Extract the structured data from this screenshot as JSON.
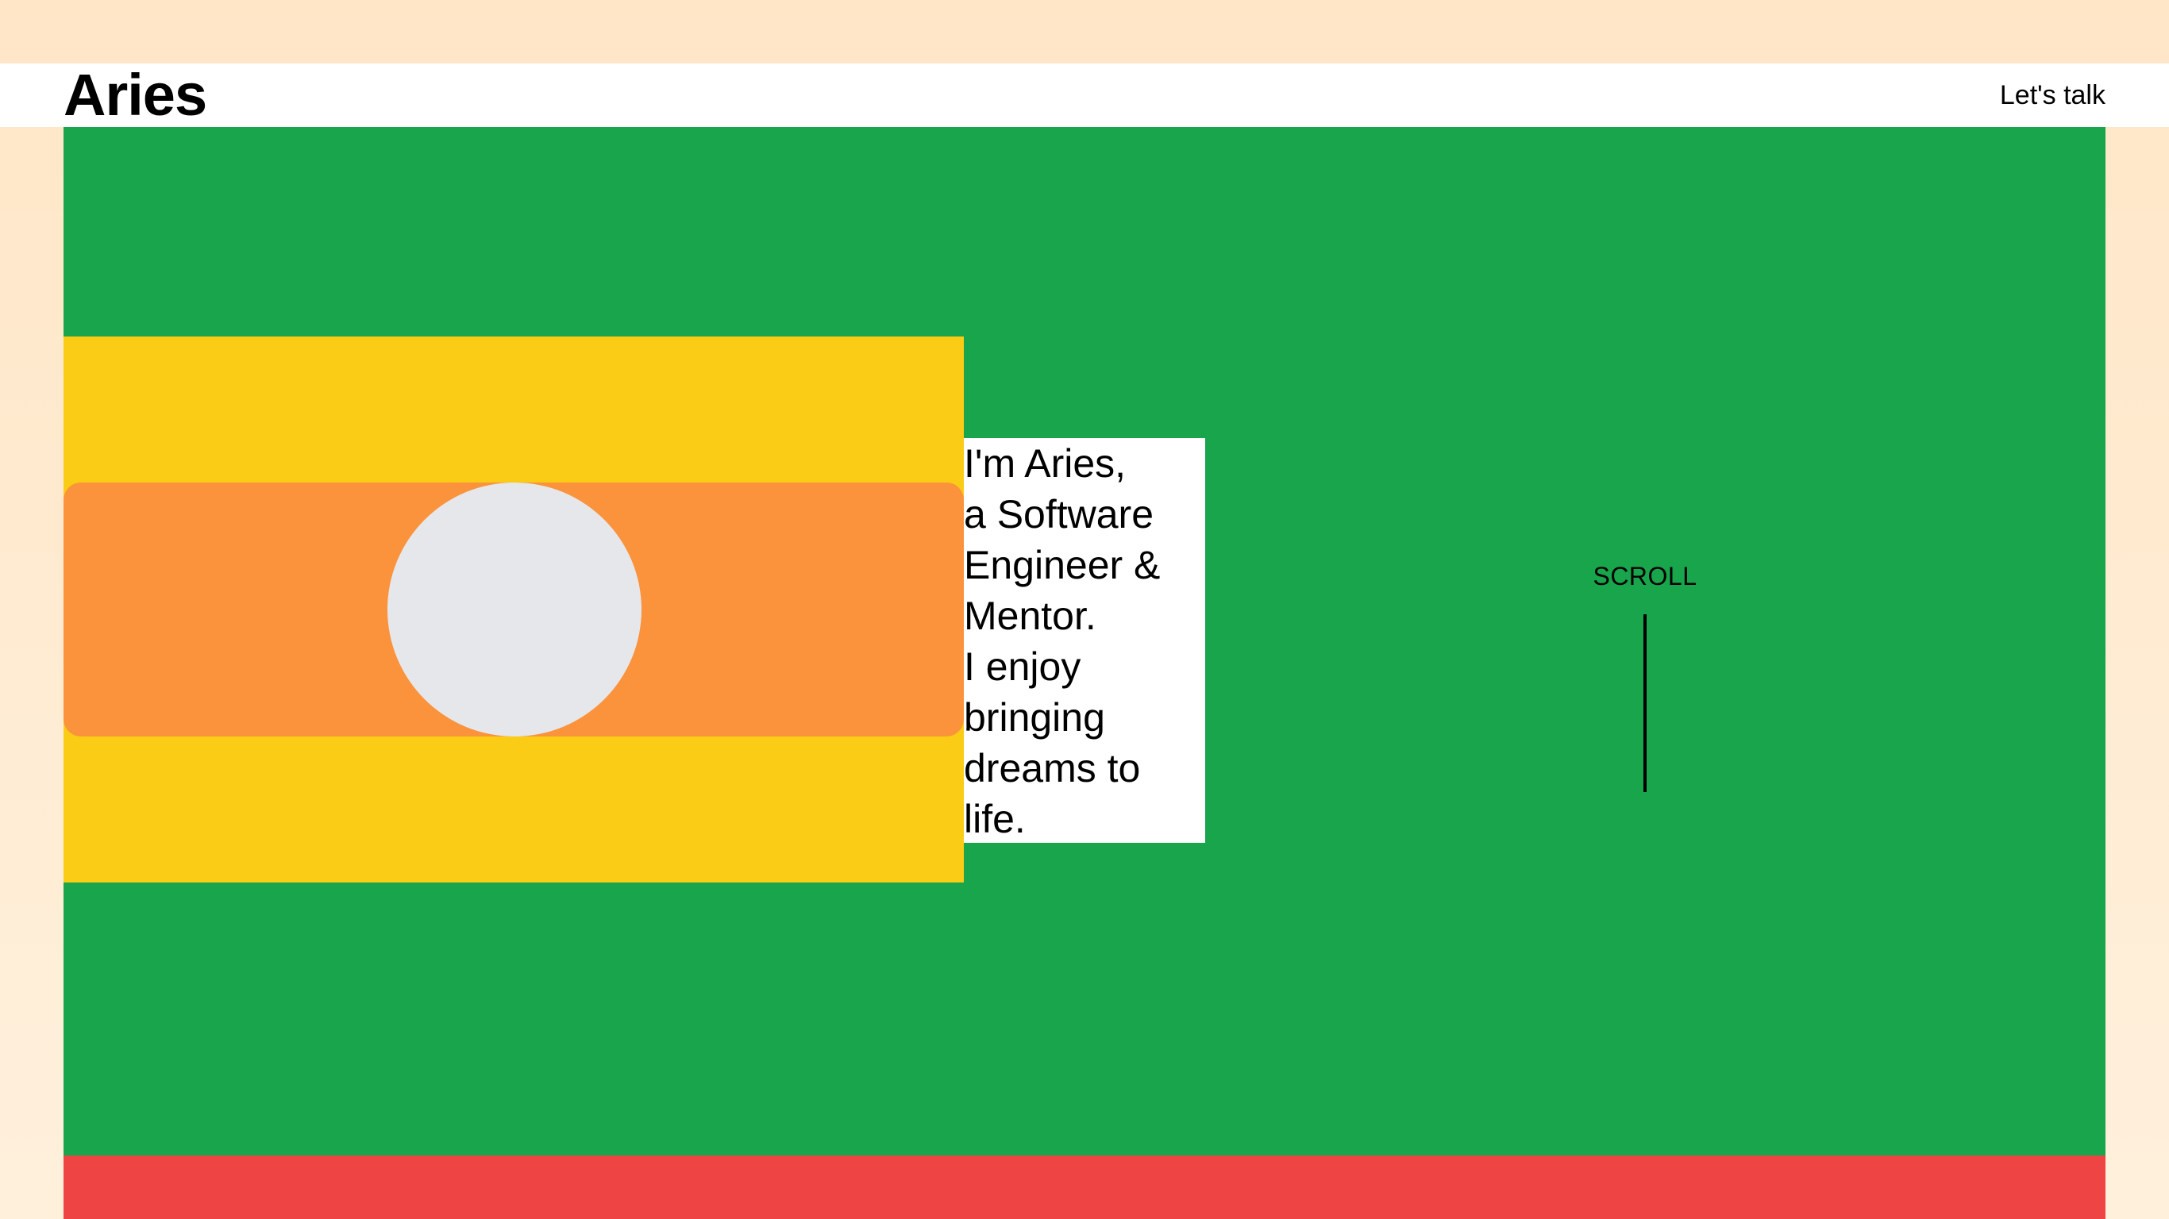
{
  "header": {
    "brand": "Aries",
    "cta_label": "Let's talk"
  },
  "hero": {
    "intro_lines": [
      "I'm Aries,",
      "a Software",
      "Engineer &",
      "Mentor.",
      "I enjoy",
      "bringing",
      "dreams to",
      "life."
    ],
    "scroll_label": "SCROLL"
  },
  "colors": {
    "page_background": "#FFE6C7",
    "hero_background": "#18A54B",
    "photo_band": "#FACC15",
    "photo_card": "#FB923C",
    "avatar_placeholder": "#E5E7EB",
    "next_section": "#EF4444"
  }
}
